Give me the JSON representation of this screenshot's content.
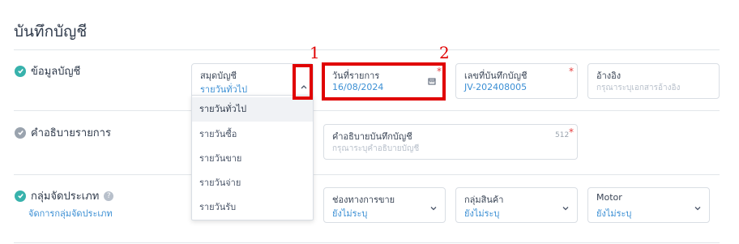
{
  "page": {
    "title": "บันทึกบัญชี"
  },
  "colors": {
    "accent": "#3b8fd4",
    "check": "#38b2ac",
    "check_muted": "#9aa3ae",
    "required": "#e53e3e",
    "highlight": "#e00000"
  },
  "sections": {
    "account_info": {
      "label": "ข้อมูลบัญชี",
      "icon": "check-circle-icon"
    },
    "description": {
      "label": "คำอธิบายรายการ",
      "icon": "check-circle-icon"
    },
    "category": {
      "label": "กลุ่มจัดประเภท",
      "help_icon": "question-icon",
      "link": "จัดการกลุ่มจัดประเภท"
    }
  },
  "fields": {
    "journal_book": {
      "label": "สมุดบัญชี",
      "value": "รายวันทั่วไป",
      "icon": "chevron-up-icon"
    },
    "transaction_date": {
      "label": "วันที่รายการ",
      "value": "16/08/2024",
      "required": "*",
      "icon": "calendar-icon"
    },
    "journal_no": {
      "label": "เลขที่บันทึกบัญชี",
      "value": "JV-202408005",
      "required": "*"
    },
    "reference": {
      "label": "อ้างอิง",
      "placeholder": "กรุณาระบุเอกสารอ้างอิง"
    },
    "journal_desc": {
      "label": "คำอธิบายบันทึกบัญชี",
      "placeholder": "กรุณาระบุคำอธิบายบัญชี",
      "counter": "512",
      "required": "*"
    },
    "sales_channel": {
      "label": "ช่องทางการขาย",
      "value": "ยังไม่ระบุ",
      "icon": "chevron-down-icon"
    },
    "product_group": {
      "label": "กลุ่มสินค้า",
      "value": "ยังไม่ระบุ",
      "icon": "chevron-down-icon"
    },
    "motor": {
      "label": "Motor",
      "value": "ยังไม่ระบุ",
      "icon": "chevron-down-icon"
    }
  },
  "journal_book_options": [
    "รายวันทั่วไป",
    "รายวันซื้อ",
    "รายวันขาย",
    "รายวันจ่าย",
    "รายวันรับ"
  ],
  "annotations": {
    "marker_1": "1",
    "marker_2": "2"
  }
}
